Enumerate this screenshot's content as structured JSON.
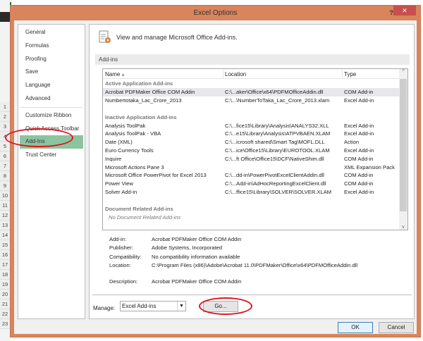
{
  "dialog": {
    "title": "Excel Options",
    "help": "?",
    "close": "✕"
  },
  "nav": {
    "items": [
      "General",
      "Formulas",
      "Proofing",
      "Save",
      "Language",
      "Advanced",
      "Customize Ribbon",
      "Quick Access Toolbar",
      "Add-Ins",
      "Trust Center"
    ],
    "selected": "Add-Ins"
  },
  "header": {
    "text": "View and manage Microsoft Office Add-ins."
  },
  "section": {
    "title": "Add-ins"
  },
  "list": {
    "columns": [
      "Name",
      "Location",
      "Type"
    ],
    "groups": [
      {
        "title": "Active Application Add-ins",
        "rows": [
          [
            "Acrobat PDFMaker Office COM Addin",
            "C:\\...aker\\Office\\x64\\PDFMOfficeAddin.dll",
            "COM Add-in"
          ],
          [
            "Numbertotaka_Lac_Crore_2013",
            "C:\\...\\NumberToTaka_Lac_Crore_2013.xlam",
            "Excel Add-in"
          ]
        ]
      },
      {
        "title": "Inactive Application Add-ins",
        "rows": [
          [
            "Analysis ToolPak",
            "C:\\...fice15\\Library\\Analysis\\ANALYS32.XLL",
            "Excel Add-in"
          ],
          [
            "Analysis ToolPak - VBA",
            "C:\\...e15\\Library\\Analysis\\ATPVBAEN.XLAM",
            "Excel Add-in"
          ],
          [
            "Date (XML)",
            "C:\\...icrosoft shared\\Smart Tag\\MOFL.DLL",
            "Action"
          ],
          [
            "Euro Currency Tools",
            "C:\\...ice\\Office15\\Library\\EUROTOOL.XLAM",
            "Excel Add-in"
          ],
          [
            "Inquire",
            "C:\\...ft Office\\Office15\\DCF\\NativeShim.dll",
            "COM Add-in"
          ],
          [
            "Microsoft Actions Pane 3",
            "",
            "XML Expansion Pack"
          ],
          [
            "Microsoft Office PowerPivot for Excel 2013",
            "C:\\...dd-in\\PowerPivotExcelClientAddIn.dll",
            "COM Add-in"
          ],
          [
            "Power View",
            "C:\\...Add-in\\AdHocReportingExcelClient.dll",
            "COM Add-in"
          ],
          [
            "Solver Add-in",
            "C:\\...ffice15\\Library\\SOLVER\\SOLVER.XLAM",
            "Excel Add-in"
          ]
        ]
      },
      {
        "title": "Document Related Add-ins",
        "empty": "No Document Related Add-ins"
      }
    ]
  },
  "details": [
    {
      "label": "Add-in:",
      "value": "Acrobat PDFMaker Office COM Addin"
    },
    {
      "label": "Publisher:",
      "value": "Adobe Systems, Incorporated"
    },
    {
      "label": "Compatibility:",
      "value": "No compatibility information available"
    },
    {
      "label": "Location:",
      "value": "C:\\Program Files (x86)\\Adobe\\Acrobat 11.0\\PDFMaker\\Office\\x64\\PDFMOfficeAddin.dll"
    },
    {
      "label": "Description:",
      "value": "Acrobat PDFMaker Office COM Addin"
    }
  ],
  "manage": {
    "label": "Manage:",
    "value": "Excel Add-ins",
    "go": "Go..."
  },
  "footer": {
    "ok": "OK",
    "cancel": "Cancel"
  },
  "excel": {
    "rows": [
      "1",
      "2",
      "3",
      "4",
      "5",
      "6",
      "7",
      "8",
      "9",
      "10",
      "11",
      "12",
      "13",
      "14",
      "15",
      "16",
      "17",
      "18",
      "19",
      "20",
      "21",
      "22",
      "23"
    ],
    "icon": "X"
  },
  "colors": {
    "title": "#d8845c",
    "selected": "#8cc4a0",
    "annotation": "#e0151e"
  }
}
